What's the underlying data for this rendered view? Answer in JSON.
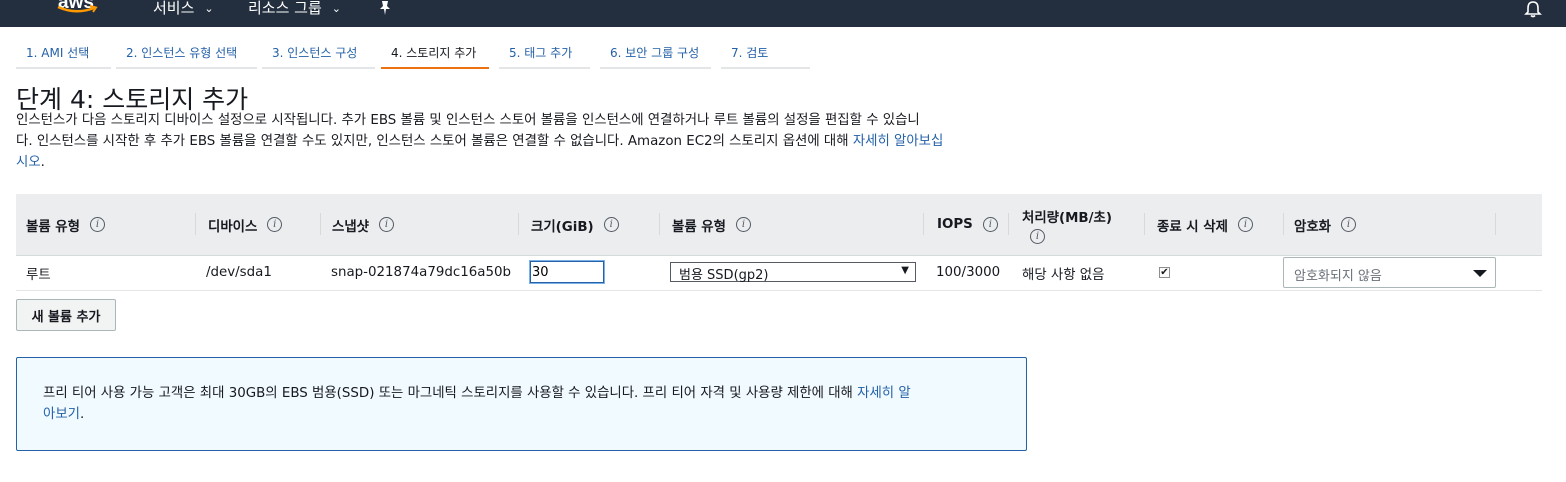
{
  "topnav": {
    "logo_text": "aws",
    "services_label": "서비스",
    "resource_groups_label": "리소스 그룹",
    "pin_icon": "pin-icon",
    "bell_icon": "bell-icon"
  },
  "tabs": [
    {
      "label": "1. AMI 선택",
      "active": false
    },
    {
      "label": "2. 인스턴스 유형 선택",
      "active": false
    },
    {
      "label": "3. 인스턴스 구성",
      "active": false
    },
    {
      "label": "4. 스토리지 추가",
      "active": true
    },
    {
      "label": "5. 태그 추가",
      "active": false
    },
    {
      "label": "6. 보안 그룹 구성",
      "active": false
    },
    {
      "label": "7. 검토",
      "active": false
    }
  ],
  "page": {
    "title": "단계 4: 스토리지 추가",
    "description_line1": "인스턴스가 다음 스토리지 디바이스 설정으로 시작됩니다. 추가 EBS 볼륨 및 인스턴스 스토어 볼륨을 인스턴스에 연결하거나 루트 볼륨의 설정을 편집할 수 있습니",
    "description_line2": "다. 인스턴스를 시작한 후 추가 EBS 볼륨을 연결할 수도 있지만, 인스턴스 스토어 볼륨은 연결할 수 없습니다. Amazon EC2의 스토리지 옵션에 대해 ",
    "description_link_a": "자세히 알아보십",
    "description_link_b": "시오",
    "description_end": "."
  },
  "table": {
    "headers": {
      "volume_type": "볼륨 유형",
      "device": "디바이스",
      "snapshot": "스냅샷",
      "size": "크기(GiB)",
      "ebs_volume_type": "볼륨 유형",
      "iops": "IOPS",
      "throughput": "처리량(MB/초)",
      "delete_on_termination": "종료 시 삭제",
      "encryption": "암호화"
    },
    "row": {
      "volume_type": "루트",
      "device": "/dev/sda1",
      "snapshot": "snap-021874a79dc16a50b",
      "size": "30",
      "ebs_volume_type": "범용 SSD(gp2)",
      "iops": "100/3000",
      "throughput": "해당 사항 없음",
      "delete_on_termination": true,
      "encryption_placeholder": "암호화되지 않음"
    }
  },
  "add_volume_button": "새 볼륨 추가",
  "alert": {
    "text_line1": "프리 티어 사용 가능 고객은 최대 30GB의 EBS 범용(SSD) 또는 마그네틱 스토리지를 사용할 수 있습니다. 프리 티어 자격 및 사용량 제한에 대해 ",
    "link_a": "자세히 알",
    "link_b": "아보기",
    "text_end": "."
  },
  "colors": {
    "nav_bg": "#232f3e",
    "link": "#2461a8",
    "active_tab": "#ec7211",
    "alert_bg": "#f1faff"
  }
}
